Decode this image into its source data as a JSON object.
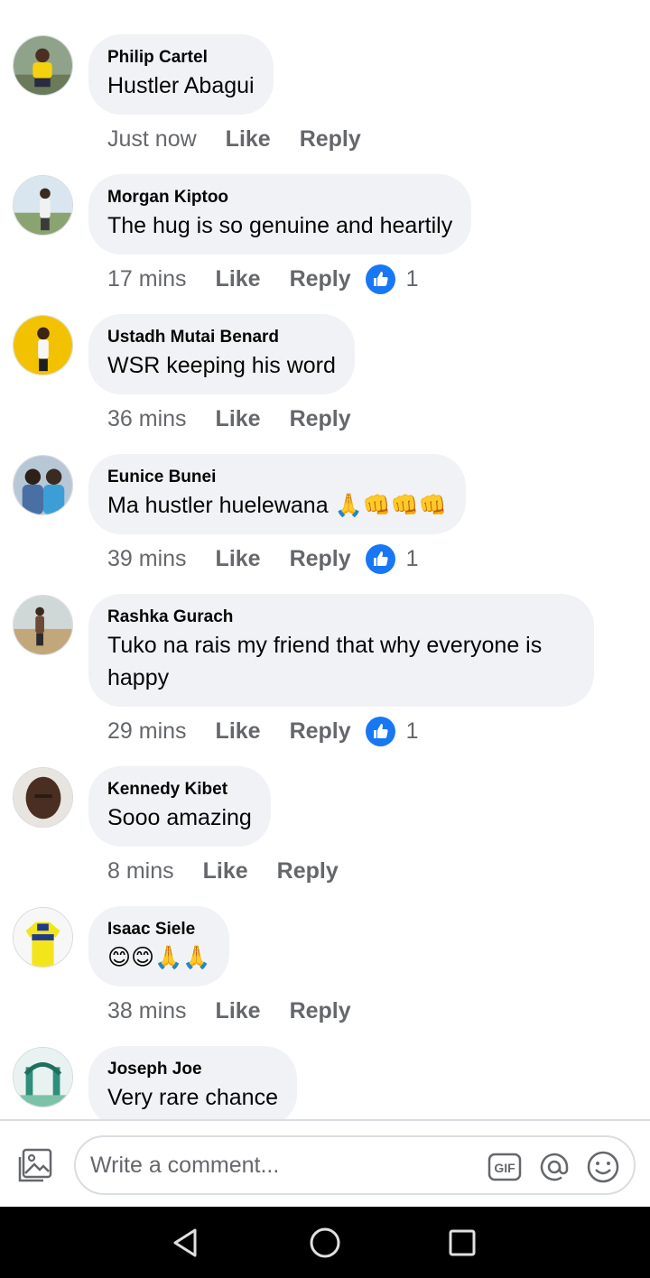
{
  "comments": [
    {
      "author": "Philip Cartel",
      "text": "Hustler Abagui",
      "time": "Just now",
      "like": "Like",
      "reply": "Reply",
      "reactions": null
    },
    {
      "author": "Morgan Kiptoo",
      "text": "The hug is so genuine and heartily",
      "time": "17 mins",
      "like": "Like",
      "reply": "Reply",
      "reactions": "1"
    },
    {
      "author": "Ustadh Mutai Benard",
      "text": "WSR keeping his word",
      "time": "36 mins",
      "like": "Like",
      "reply": "Reply",
      "reactions": null
    },
    {
      "author": "Eunice Bunei",
      "text": "Ma hustler huelewana 🙏👊👊👊",
      "time": "39 mins",
      "like": "Like",
      "reply": "Reply",
      "reactions": "1"
    },
    {
      "author": "Rashka Gurach",
      "text": "Tuko na rais my friend that why everyone is happy",
      "time": "29 mins",
      "like": "Like",
      "reply": "Reply",
      "reactions": "1"
    },
    {
      "author": "Kennedy Kibet",
      "text": "Sooo amazing",
      "time": "8 mins",
      "like": "Like",
      "reply": "Reply",
      "reactions": null
    },
    {
      "author": "Isaac Siele",
      "text": "😊😊🙏🙏",
      "time": "38 mins",
      "like": "Like",
      "reply": "Reply",
      "reactions": null
    },
    {
      "author": "Joseph Joe",
      "text": "Very rare chance",
      "time": "",
      "like": "",
      "reply": "",
      "reactions": null
    }
  ],
  "composer": {
    "placeholder": "Write a comment...",
    "icons": [
      "photo-icon",
      "gif-icon",
      "at-mention-icon",
      "emoji-icon"
    ]
  },
  "navbar": {
    "icons": [
      "back-icon",
      "home-icon",
      "recents-icon"
    ]
  },
  "colors": {
    "bubble": "#f0f2f5",
    "meta_text": "#65676b",
    "like_blue": "#1877f2",
    "navbar": "#000000"
  }
}
